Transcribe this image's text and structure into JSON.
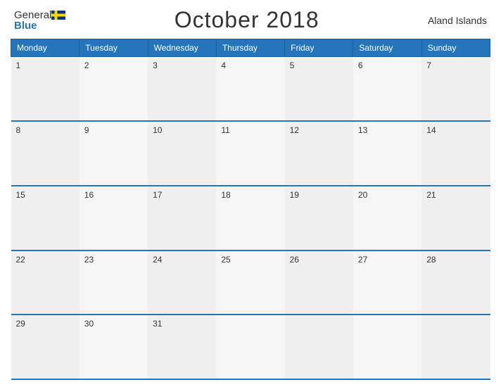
{
  "header": {
    "logo_general": "General",
    "logo_blue": "Blue",
    "title": "October 2018",
    "region": "Aland Islands"
  },
  "calendar": {
    "days_of_week": [
      "Monday",
      "Tuesday",
      "Wednesday",
      "Thursday",
      "Friday",
      "Saturday",
      "Sunday"
    ],
    "weeks": [
      [
        {
          "day": 1,
          "empty": false
        },
        {
          "day": 2,
          "empty": false
        },
        {
          "day": 3,
          "empty": false
        },
        {
          "day": 4,
          "empty": false
        },
        {
          "day": 5,
          "empty": false
        },
        {
          "day": 6,
          "empty": false
        },
        {
          "day": 7,
          "empty": false
        }
      ],
      [
        {
          "day": 8,
          "empty": false
        },
        {
          "day": 9,
          "empty": false
        },
        {
          "day": 10,
          "empty": false
        },
        {
          "day": 11,
          "empty": false
        },
        {
          "day": 12,
          "empty": false
        },
        {
          "day": 13,
          "empty": false
        },
        {
          "day": 14,
          "empty": false
        }
      ],
      [
        {
          "day": 15,
          "empty": false
        },
        {
          "day": 16,
          "empty": false
        },
        {
          "day": 17,
          "empty": false
        },
        {
          "day": 18,
          "empty": false
        },
        {
          "day": 19,
          "empty": false
        },
        {
          "day": 20,
          "empty": false
        },
        {
          "day": 21,
          "empty": false
        }
      ],
      [
        {
          "day": 22,
          "empty": false
        },
        {
          "day": 23,
          "empty": false
        },
        {
          "day": 24,
          "empty": false
        },
        {
          "day": 25,
          "empty": false
        },
        {
          "day": 26,
          "empty": false
        },
        {
          "day": 27,
          "empty": false
        },
        {
          "day": 28,
          "empty": false
        }
      ],
      [
        {
          "day": 29,
          "empty": false
        },
        {
          "day": 30,
          "empty": false
        },
        {
          "day": 31,
          "empty": false
        },
        {
          "day": null,
          "empty": true
        },
        {
          "day": null,
          "empty": true
        },
        {
          "day": null,
          "empty": true
        },
        {
          "day": null,
          "empty": true
        }
      ]
    ]
  }
}
